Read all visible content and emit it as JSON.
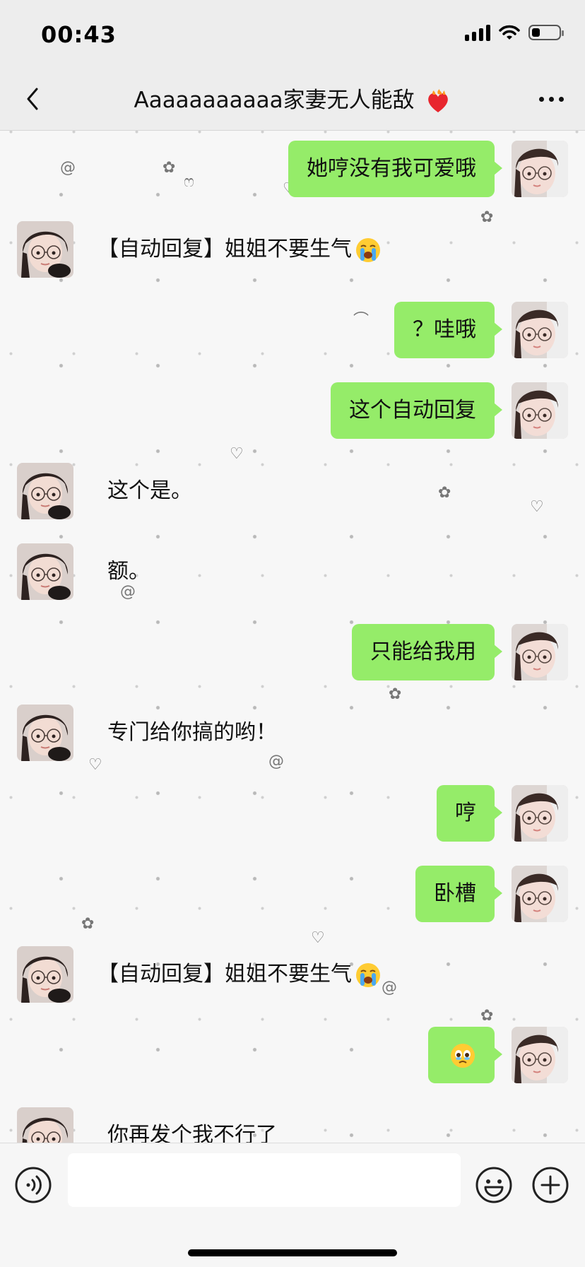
{
  "status_bar": {
    "time": "00:43",
    "battery_level": 0.3,
    "icons": [
      "signal-icon",
      "wifi-icon",
      "battery-icon"
    ]
  },
  "nav": {
    "title": "Aaaaaaaaaaa家妻无人能敌",
    "title_emoji": "heart-on-fire-icon",
    "back_icon": "chevron-left-icon",
    "more_icon": "more-dots-icon"
  },
  "colors": {
    "bubble_out": "#95ec69",
    "background": "#ededed",
    "chat_bg": "#f7f7f7"
  },
  "messages": [
    {
      "side": "out",
      "text": "她哼没有我可爱哦"
    },
    {
      "side": "in",
      "text": "【自动回复】姐姐不要生气",
      "emoji": "loudly-crying-face"
    },
    {
      "side": "out",
      "text": "？哇哦"
    },
    {
      "side": "out",
      "text": "这个自动回复"
    },
    {
      "side": "in",
      "text": "这个是。"
    },
    {
      "side": "in",
      "text": "额。"
    },
    {
      "side": "out",
      "text": "只能给我用"
    },
    {
      "side": "in",
      "text": "专门给你搞的哟！"
    },
    {
      "side": "out",
      "text": "哼"
    },
    {
      "side": "out",
      "text": "卧槽"
    },
    {
      "side": "in",
      "text": "【自动回复】姐姐不要生气",
      "emoji": "loudly-crying-face"
    },
    {
      "side": "out",
      "text": "",
      "emoji": "face-holding-back-tears"
    },
    {
      "side": "in",
      "text": "你再发个我不行了"
    }
  ],
  "input_bar": {
    "placeholder": "",
    "icons": [
      "voice-icon",
      "emoji-face-icon",
      "plus-icon"
    ]
  }
}
